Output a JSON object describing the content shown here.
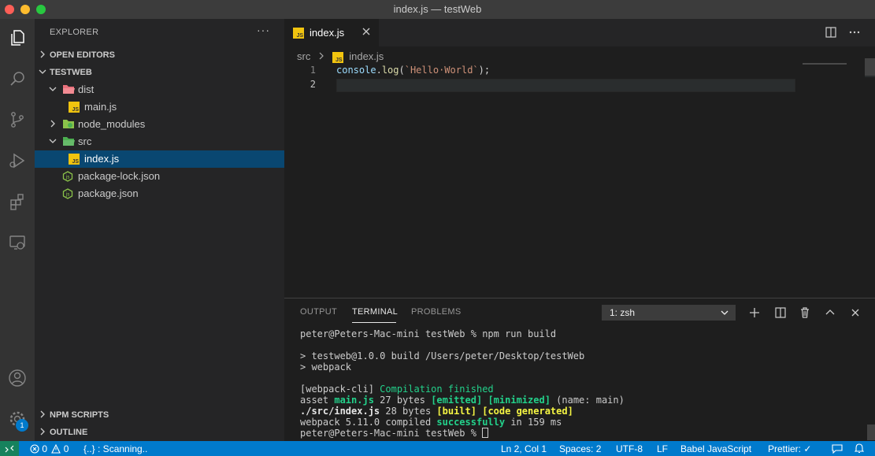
{
  "window": {
    "title": "index.js — testWeb"
  },
  "sidebar": {
    "title": "EXPLORER",
    "more": "···",
    "sections": {
      "open_editors": "OPEN EDITORS",
      "workspace": "TESTWEB",
      "npm_scripts": "NPM SCRIPTS",
      "outline": "OUTLINE"
    },
    "tree": {
      "dist": "dist",
      "main_js": "main.js",
      "node_modules": "node_modules",
      "src": "src",
      "index_js": "index.js",
      "package_lock": "package-lock.json",
      "package_json": "package.json"
    }
  },
  "activity": {
    "settings_badge": "1"
  },
  "editor": {
    "tab_label": "index.js",
    "breadcrumb": {
      "folder": "src",
      "file": "index.js"
    },
    "line_numbers": [
      "1",
      "2"
    ],
    "code": {
      "object": "console",
      "dot": ".",
      "method": "log",
      "paren_open": "(",
      "string": "`Hello·World`",
      "paren_close": ");"
    }
  },
  "panel": {
    "tabs": {
      "output": "OUTPUT",
      "terminal": "TERMINAL",
      "problems": "PROBLEMS"
    },
    "terminal_select": "1: zsh",
    "terminal": {
      "l1": "peter@Peters-Mac-mini testWeb % npm run build",
      "l3": "> testweb@1.0.0 build /Users/peter/Desktop/testWeb",
      "l4": "> webpack",
      "l6a": "[webpack-cli] ",
      "l6b": "Compilation finished",
      "l7a": "asset ",
      "l7b": "main.js",
      "l7c": " 27 bytes ",
      "l7d": "[emitted]",
      "l7e": " ",
      "l7f": "[minimized]",
      "l7g": " (name: main)",
      "l8a": "./src/index.js",
      "l8b": " 28 bytes ",
      "l8c": "[built]",
      "l8d": " ",
      "l8e": "[code generated]",
      "l9a": "webpack 5.11.0 compiled ",
      "l9b": "successfully",
      "l9c": " in 159 ms",
      "l10": "peter@Peters-Mac-mini testWeb % "
    }
  },
  "status": {
    "errors": "0",
    "warnings": "0",
    "scanning": "{..} : Scanning..",
    "position": "Ln 2, Col 1",
    "spaces": "Spaces: 2",
    "encoding": "UTF-8",
    "eol": "LF",
    "language": "Babel JavaScript",
    "prettier": "Prettier: ✓"
  },
  "colors": {
    "accent": "#007acc",
    "selection": "#094771",
    "js_icon": "#f1c40f",
    "terminal_green": "#23d18b",
    "terminal_yellow": "#f5f543"
  }
}
